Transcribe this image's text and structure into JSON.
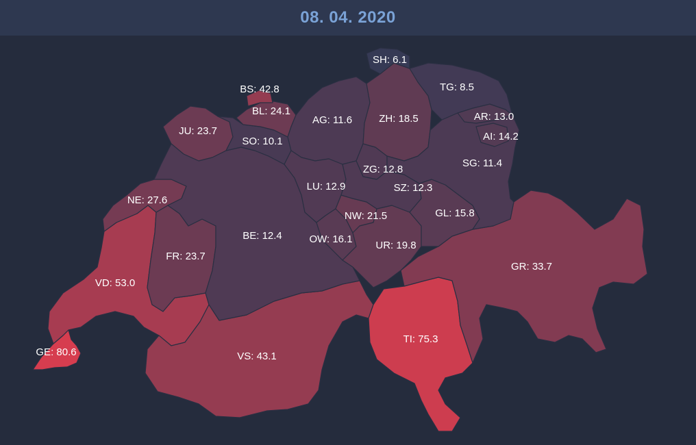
{
  "header": {
    "date": "08. 04. 2020"
  },
  "colors": {
    "background": "#252c3d",
    "header_bg": "#2e3850",
    "date_text": "#7aa2d6",
    "scale_low": "#363a55",
    "scale_high": "#d63d4f"
  },
  "cantons": [
    {
      "code": "GE",
      "label": "GE: 80.6",
      "value": 80.6
    },
    {
      "code": "VD",
      "label": "VD: 53.0",
      "value": 53.0
    },
    {
      "code": "VS",
      "label": "VS: 43.1",
      "value": 43.1
    },
    {
      "code": "TI",
      "label": "TI: 75.3",
      "value": 75.3
    },
    {
      "code": "GR",
      "label": "GR: 33.7",
      "value": 33.7
    },
    {
      "code": "FR",
      "label": "FR: 23.7",
      "value": 23.7
    },
    {
      "code": "NE",
      "label": "NE: 27.6",
      "value": 27.6
    },
    {
      "code": "JU",
      "label": "JU: 23.7",
      "value": 23.7
    },
    {
      "code": "BE",
      "label": "BE: 12.4",
      "value": 12.4
    },
    {
      "code": "SO",
      "label": "SO: 10.1",
      "value": 10.1
    },
    {
      "code": "BL",
      "label": "BL: 24.1",
      "value": 24.1
    },
    {
      "code": "BS",
      "label": "BS: 42.8",
      "value": 42.8
    },
    {
      "code": "AG",
      "label": "AG: 11.6",
      "value": 11.6
    },
    {
      "code": "LU",
      "label": "LU: 12.9",
      "value": 12.9
    },
    {
      "code": "OW",
      "label": "OW: 16.1",
      "value": 16.1
    },
    {
      "code": "NW",
      "label": "NW: 21.5",
      "value": 21.5
    },
    {
      "code": "UR",
      "label": "UR: 19.8",
      "value": 19.8
    },
    {
      "code": "ZG",
      "label": "ZG: 12.8",
      "value": 12.8
    },
    {
      "code": "SZ",
      "label": "SZ: 12.3",
      "value": 12.3
    },
    {
      "code": "ZH",
      "label": "ZH: 18.5",
      "value": 18.5
    },
    {
      "code": "GL",
      "label": "GL: 15.8",
      "value": 15.8
    },
    {
      "code": "SG",
      "label": "SG: 11.4",
      "value": 11.4
    },
    {
      "code": "AR",
      "label": "AR: 13.0",
      "value": 13.0
    },
    {
      "code": "AI",
      "label": "AI: 14.2",
      "value": 14.2
    },
    {
      "code": "TG",
      "label": "TG: 8.5",
      "value": 8.5
    },
    {
      "code": "SH",
      "label": "SH: 6.1",
      "value": 6.1
    }
  ]
}
